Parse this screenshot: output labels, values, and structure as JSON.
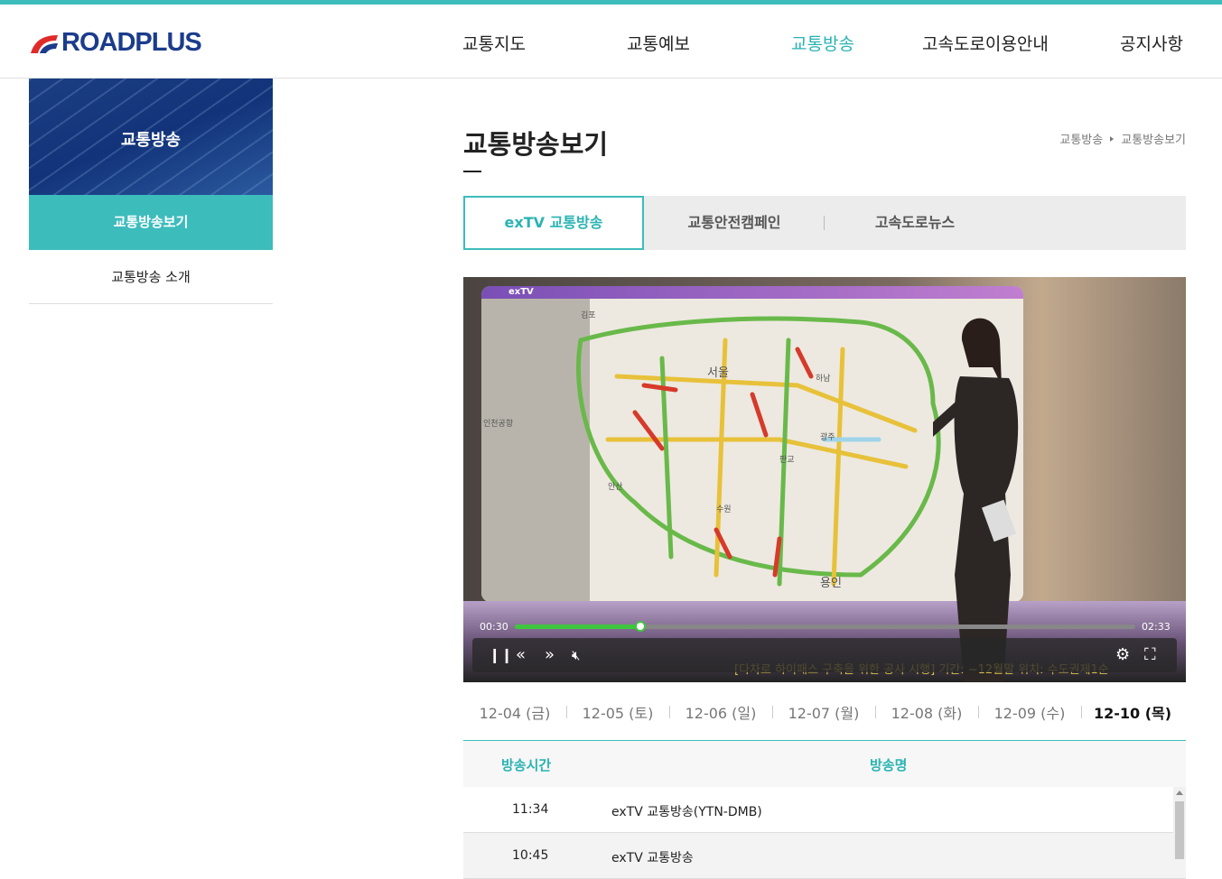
{
  "brand": {
    "name": "ROADPLUS",
    "accent": "#3dbcbc",
    "logo_blue": "#1b3c8c",
    "logo_red": "#e02b2b"
  },
  "nav": {
    "items": [
      {
        "label": "교통지도"
      },
      {
        "label": "교통예보"
      },
      {
        "label": "교통방송"
      },
      {
        "label": "고속도로이용안내"
      },
      {
        "label": "공지사항"
      }
    ],
    "active": "교통방송"
  },
  "sidebar": {
    "banner_title": "교통방송",
    "items": [
      {
        "label": "교통방송보기"
      },
      {
        "label": "교통방송 소개"
      }
    ]
  },
  "main": {
    "title": "교통방송보기",
    "breadcrumb": [
      "교통방송",
      "교통방송보기"
    ],
    "tabs": [
      {
        "label": "exTV 교통방송"
      },
      {
        "label": "교통안전캠페인"
      },
      {
        "label": "고속도로뉴스"
      }
    ]
  },
  "player": {
    "channel_logo": "exTV",
    "current_time": "00:30",
    "duration": "02:33",
    "progress": 0.2,
    "map_labels": [
      "서울",
      "용인",
      "인천공항",
      "판교",
      "광주",
      "안산",
      "수원",
      "하남",
      "김포"
    ],
    "ticker": "[다차로 하이패스 구축을 위한 공사 시행]  기간: ~12월말   위치: 수도권제1순"
  },
  "dates": [
    {
      "label": "12-04 (금)"
    },
    {
      "label": "12-05 (토)"
    },
    {
      "label": "12-06 (일)"
    },
    {
      "label": "12-07 (월)"
    },
    {
      "label": "12-08 (화)"
    },
    {
      "label": "12-09 (수)"
    },
    {
      "label": "12-10 (목)"
    }
  ],
  "table": {
    "headers": {
      "time": "방송시간",
      "name": "방송명"
    },
    "rows": [
      {
        "time": "11:34",
        "name": "exTV 교통방송(YTN-DMB)"
      },
      {
        "time": "10:45",
        "name": "exTV 교통방송"
      }
    ]
  }
}
